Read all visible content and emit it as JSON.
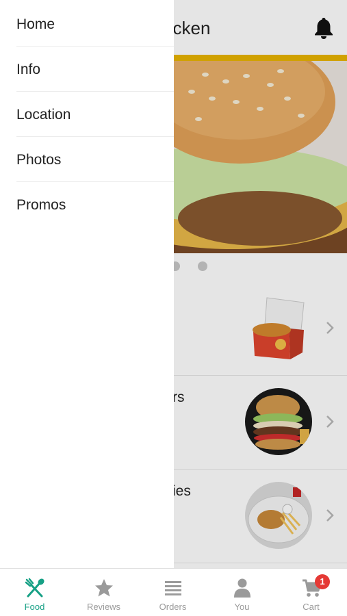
{
  "header": {
    "title": "Ked Chicken"
  },
  "menu_rows": [
    {
      "label": ""
    },
    {
      "label": "rs"
    },
    {
      "label": "ies"
    }
  ],
  "drawer": {
    "items": [
      {
        "label": "Home"
      },
      {
        "label": "Info"
      },
      {
        "label": "Location"
      },
      {
        "label": "Photos"
      },
      {
        "label": "Promos"
      }
    ]
  },
  "tabbar": {
    "tabs": [
      {
        "label": "Food",
        "icon": "utensils-icon",
        "active": true
      },
      {
        "label": "Reviews",
        "icon": "star-icon"
      },
      {
        "label": "Orders",
        "icon": "list-icon"
      },
      {
        "label": "You",
        "icon": "person-icon"
      },
      {
        "label": "Cart",
        "icon": "cart-icon",
        "badge": "1"
      }
    ]
  },
  "colors": {
    "accent": "#16a085",
    "gold": "#e8b400",
    "badge": "#e53935"
  }
}
